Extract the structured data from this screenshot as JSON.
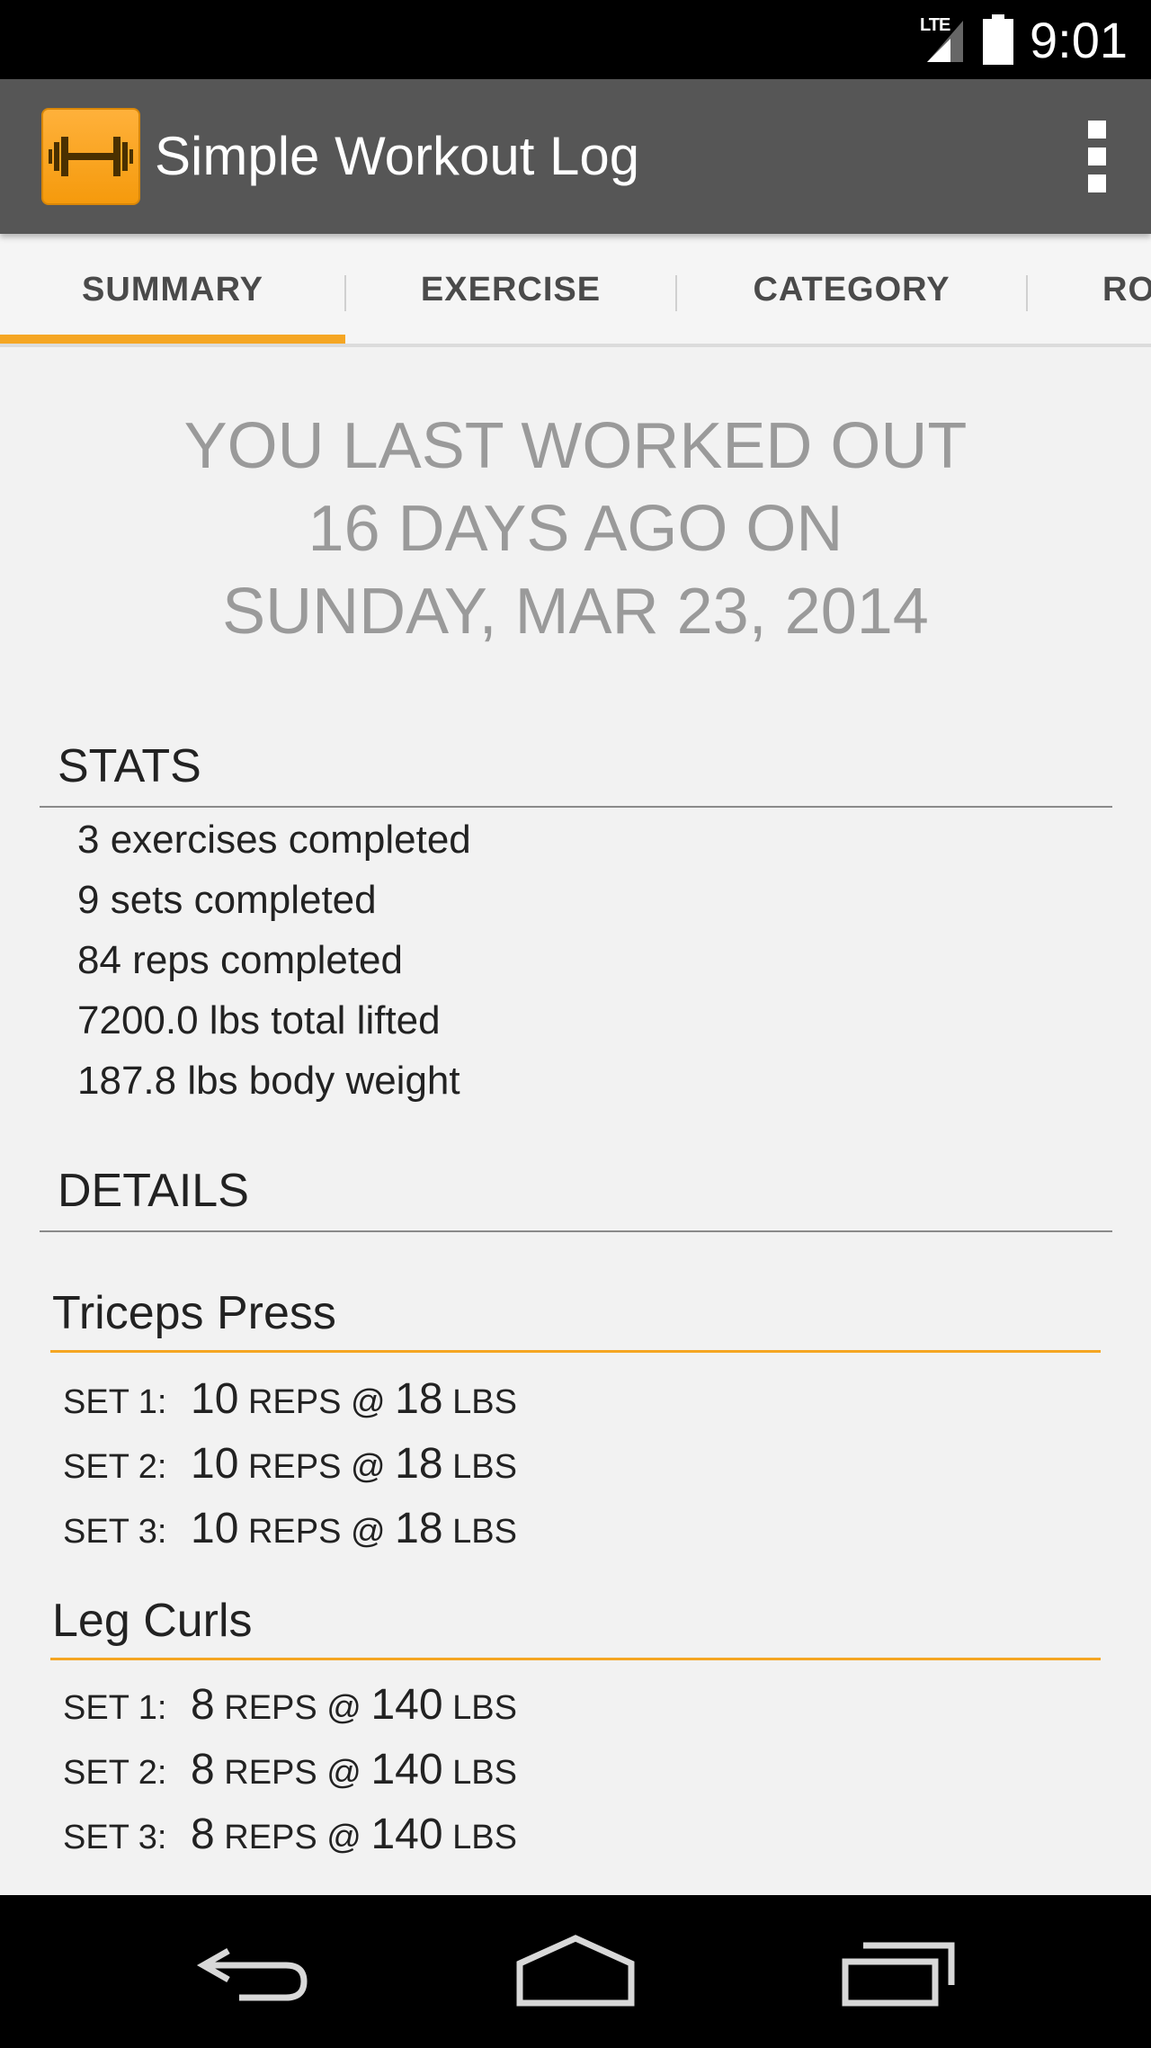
{
  "status_bar": {
    "network": "LTE",
    "time": "9:01"
  },
  "action_bar": {
    "title": "Simple Workout Log"
  },
  "tabs": [
    {
      "label": "SUMMARY",
      "selected": true
    },
    {
      "label": "EXERCISE",
      "selected": false
    },
    {
      "label": "CATEGORY",
      "selected": false
    },
    {
      "label": "RO",
      "selected": false
    }
  ],
  "headline": {
    "line1": "YOU LAST WORKED OUT",
    "line2": "16 DAYS AGO ON",
    "line3": "SUNDAY, MAR 23, 2014"
  },
  "stats": {
    "header": "STATS",
    "items": [
      "3 exercises completed",
      "9 sets completed",
      "84 reps completed",
      "7200.0 lbs total lifted",
      "187.8 lbs body weight"
    ]
  },
  "details": {
    "header": "DETAILS",
    "exercises": [
      {
        "name": "Triceps Press",
        "sets": [
          {
            "label": "SET 1:",
            "reps": "10",
            "reps_unit": "REPS @",
            "weight": "18",
            "weight_unit": "LBS"
          },
          {
            "label": "SET 2:",
            "reps": "10",
            "reps_unit": "REPS @",
            "weight": "18",
            "weight_unit": "LBS"
          },
          {
            "label": "SET 3:",
            "reps": "10",
            "reps_unit": "REPS @",
            "weight": "18",
            "weight_unit": "LBS"
          }
        ]
      },
      {
        "name": "Leg Curls",
        "sets": [
          {
            "label": "SET 1:",
            "reps": "8",
            "reps_unit": "REPS @",
            "weight": "140",
            "weight_unit": "LBS"
          },
          {
            "label": "SET 2:",
            "reps": "8",
            "reps_unit": "REPS @",
            "weight": "140",
            "weight_unit": "LBS"
          },
          {
            "label": "SET 3:",
            "reps": "8",
            "reps_unit": "REPS @",
            "weight": "140",
            "weight_unit": "LBS"
          }
        ]
      }
    ]
  },
  "colors": {
    "accent": "#f5a623",
    "action_bar": "#565656",
    "headline": "#9a9a9a"
  },
  "icons": {
    "app": "dumbbell-icon",
    "overflow": "overflow-menu-icon",
    "back": "back-icon",
    "home": "home-icon",
    "recents": "recents-icon"
  }
}
